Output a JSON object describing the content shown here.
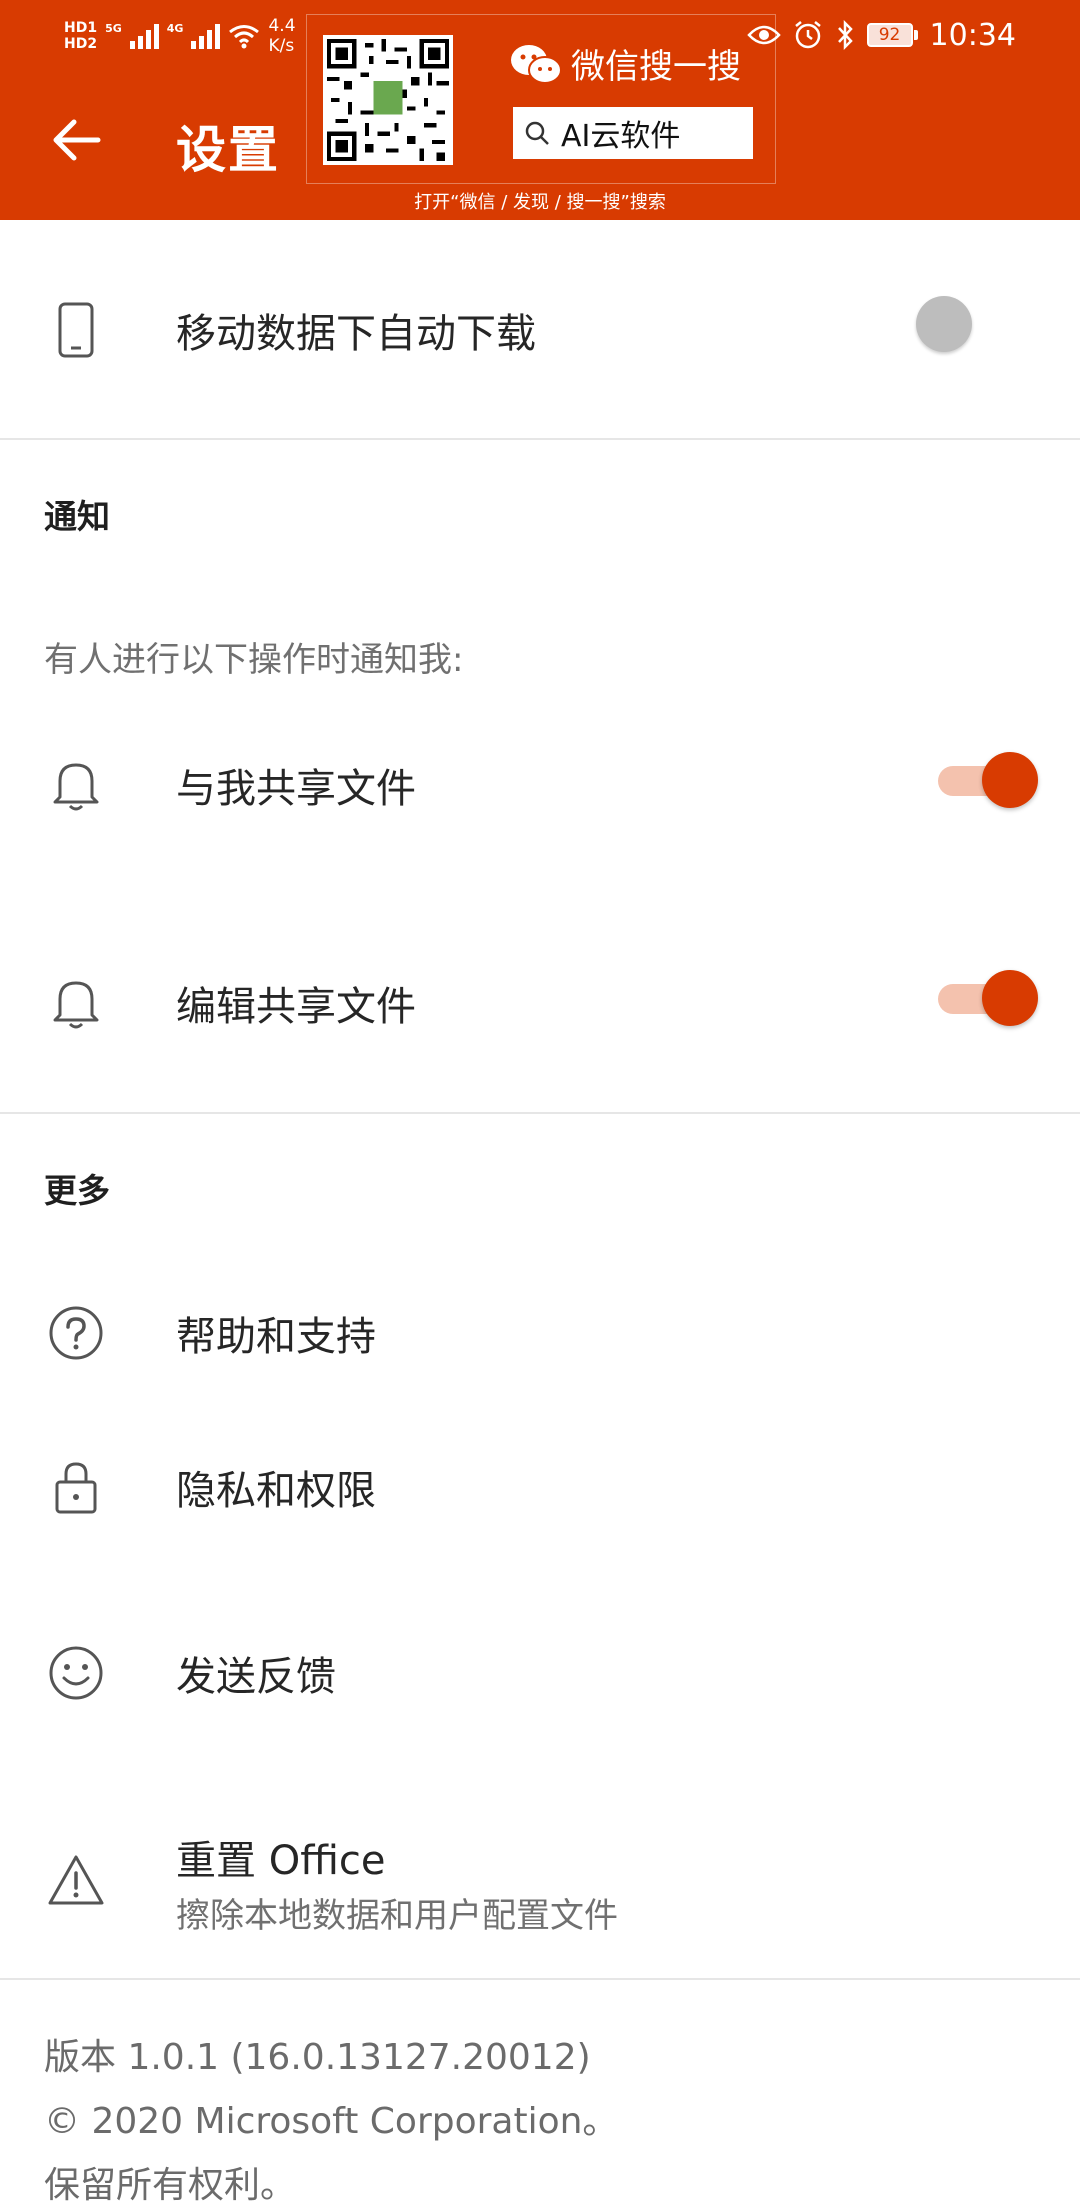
{
  "status": {
    "hd1": "HD1",
    "hd2": "HD2",
    "net1": "5G",
    "net2": "4G",
    "speed_value": "4.4",
    "speed_unit": "K/s",
    "battery": "92",
    "time": "10:34"
  },
  "header": {
    "title": "设置"
  },
  "promo": {
    "wechat_label": "微信搜一搜",
    "search_text": "AI云软件",
    "caption": "打开“微信 / 发现 / 搜一搜”搜索"
  },
  "mobile_data": {
    "label": "移动数据下自动下载",
    "toggle_on": false
  },
  "notifications": {
    "heading": "通知",
    "hint": "有人进行以下操作时通知我:",
    "items": [
      {
        "label": "与我共享文件",
        "toggle_on": true
      },
      {
        "label": "编辑共享文件",
        "toggle_on": true
      }
    ]
  },
  "more": {
    "heading": "更多",
    "items": [
      {
        "label": "帮助和支持",
        "icon": "help-icon"
      },
      {
        "label": "隐私和权限",
        "icon": "lock-icon"
      },
      {
        "label": "发送反馈",
        "icon": "smiley-icon"
      }
    ],
    "reset": {
      "label": "重置 Office",
      "subtitle": "擦除本地数据和用户配置文件",
      "icon": "warning-icon"
    }
  },
  "footer": {
    "version": "版本 1.0.1 (16.0.13127.20012)",
    "copyright": "© 2020 Microsoft Corporation。",
    "rights": "保留所有权利。"
  },
  "colors": {
    "accent": "#D83B01",
    "toggle_track_on": "#F4C2AE",
    "toggle_off": "#BDBDBD"
  }
}
